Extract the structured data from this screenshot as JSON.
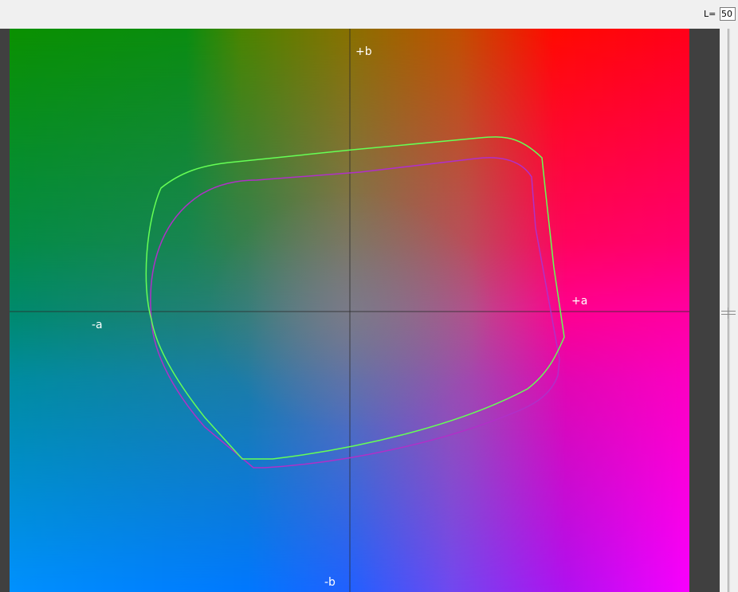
{
  "toolbar": {
    "lightness_label": "L=",
    "lightness_value": "50"
  },
  "plot": {
    "axis_labels": {
      "plus_b": "+b",
      "minus_b": "-b",
      "plus_a": "+a",
      "minus_a": "-a"
    },
    "gamut_colors": {
      "outer": "#66ff55",
      "inner": "#b030c8"
    },
    "crosshair_color": "#303030"
  },
  "slider": {
    "lightness_level": 0.5
  }
}
